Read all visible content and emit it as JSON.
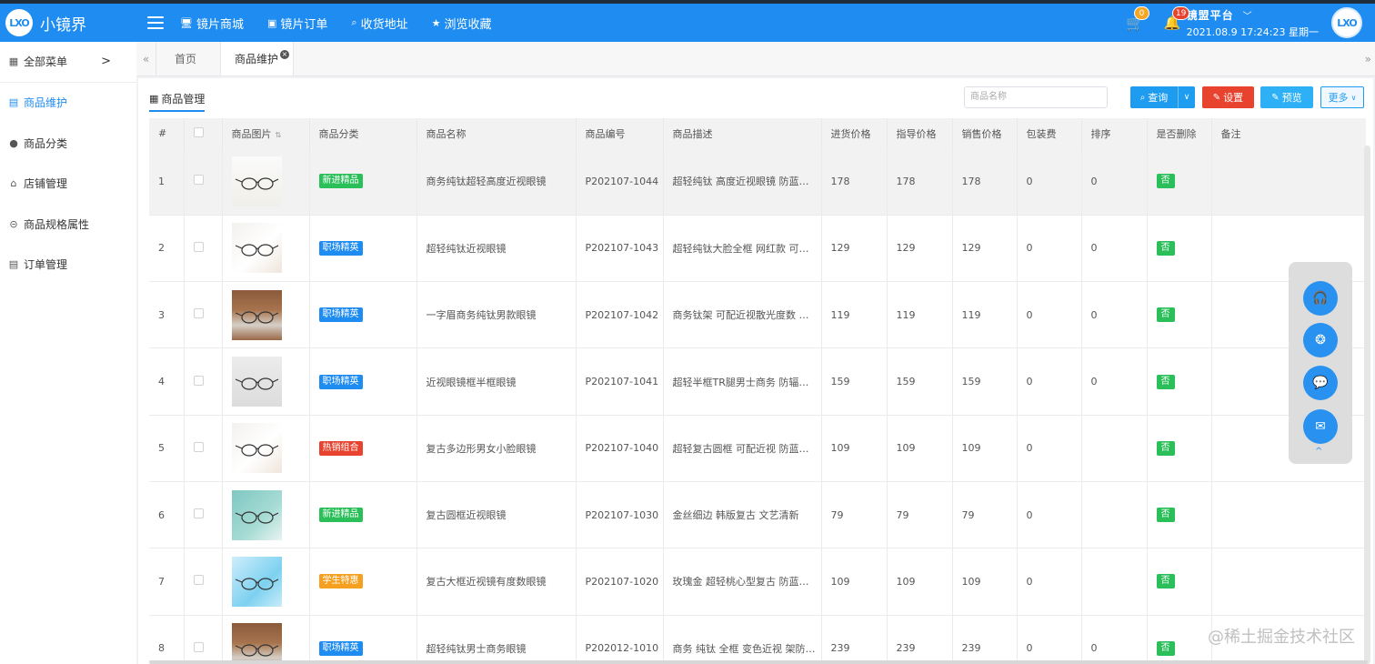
{
  "app": {
    "logo": "LXO",
    "title": "小镜界"
  },
  "nav": [
    {
      "icon": "🖥",
      "label": "镜片商城"
    },
    {
      "icon": "▣",
      "label": "镜片订单"
    },
    {
      "icon": "⌕",
      "label": "收货地址"
    },
    {
      "icon": "★",
      "label": "浏览收藏"
    }
  ],
  "topright": {
    "cart_count": "0",
    "bell_count": "19",
    "platform": "镜盟平台",
    "datetime": "2021.08.9 17:24:23 星期一",
    "avatar": "LXO"
  },
  "sidebar": [
    {
      "icon": "▦",
      "label": "全部菜单",
      "arrow": ">"
    },
    {
      "icon": "▤",
      "label": "商品维护"
    },
    {
      "icon": "●",
      "label": "商品分类"
    },
    {
      "icon": "⌂",
      "label": "店铺管理"
    },
    {
      "icon": "⊝",
      "label": "商品规格属性"
    },
    {
      "icon": "▤",
      "label": "订单管理"
    }
  ],
  "tabs": {
    "prev": "«",
    "home": "首页",
    "active": "商品维护",
    "next": "»"
  },
  "panel": {
    "title": "商品管理",
    "search_placeholder": "商品名称",
    "query_label": "查询",
    "setting_label": "设置",
    "preview_label": "预览",
    "more_label": "更多"
  },
  "table": {
    "headers": [
      "#",
      "",
      "商品图片",
      "商品分类",
      "商品名称",
      "商品编号",
      "商品描述",
      "进货价格",
      "指导价格",
      "销售价格",
      "包装费",
      "排序",
      "是否删除",
      "备注"
    ],
    "rows": [
      {
        "no": "1",
        "tag": "新进精品",
        "tag_color": "#2bbf5a",
        "name": "商务纯钛超轻高度近视眼镜",
        "code": "P202107-1044",
        "desc": "超轻纯钛 高度近视眼镜 防蓝…",
        "buy": "178",
        "guide": "178",
        "sale": "178",
        "pack": "0",
        "sort": "0",
        "del": "否",
        "img": "white"
      },
      {
        "no": "2",
        "tag": "职场精英",
        "tag_color": "#1e8cf0",
        "name": "超轻纯钛近视眼镜",
        "code": "P202107-1043",
        "desc": "超轻纯钛大脸全框 网红款 可…",
        "buy": "129",
        "guide": "129",
        "sale": "129",
        "pack": "0",
        "sort": "0",
        "del": "否",
        "img": "flowers"
      },
      {
        "no": "3",
        "tag": "职场精英",
        "tag_color": "#1e8cf0",
        "name": "一字眉商务纯钛男款眼镜",
        "code": "P202107-1042",
        "desc": "商务钛架 可配近视散光度数 …",
        "buy": "119",
        "guide": "119",
        "sale": "119",
        "pack": "0",
        "sort": "0",
        "del": "否",
        "img": "wood"
      },
      {
        "no": "4",
        "tag": "职场精英",
        "tag_color": "#1e8cf0",
        "name": "近视眼镜框半框眼镜",
        "code": "P202107-1041",
        "desc": "超轻半框TR腿男士商务 防辐…",
        "buy": "159",
        "guide": "159",
        "sale": "159",
        "pack": "0",
        "sort": "0",
        "del": "否",
        "img": "gray"
      },
      {
        "no": "5",
        "tag": "热销组合",
        "tag_color": "#e8432f",
        "name": "复古多边形男女小脸眼镜",
        "code": "P202107-1040",
        "desc": "超轻复古圆框 可配近视 防蓝…",
        "buy": "109",
        "guide": "109",
        "sale": "109",
        "pack": "0",
        "sort": "",
        "del": "否",
        "img": "flowers"
      },
      {
        "no": "6",
        "tag": "新进精品",
        "tag_color": "#2bbf5a",
        "name": "复古圆框近视眼镜",
        "code": "P202107-1030",
        "desc": "金丝细边 韩版复古 文艺清新",
        "buy": "79",
        "guide": "79",
        "sale": "79",
        "pack": "0",
        "sort": "",
        "del": "否",
        "img": "teal"
      },
      {
        "no": "7",
        "tag": "学生特惠",
        "tag_color": "#f5a020",
        "name": "复古大框近视镜有度数眼镜",
        "code": "P202107-1020",
        "desc": "玫瑰金 超轻桃心型复古 防蓝…",
        "buy": "109",
        "guide": "109",
        "sale": "109",
        "pack": "0",
        "sort": "",
        "del": "否",
        "img": "keyboard"
      },
      {
        "no": "8",
        "tag": "职场精英",
        "tag_color": "#1e8cf0",
        "name": "超轻纯钛男士商务眼镜",
        "code": "P202012-1010",
        "desc": "商务 纯钛 全框 变色近视 架防…",
        "buy": "239",
        "guide": "239",
        "sale": "239",
        "pack": "0",
        "sort": "0",
        "del": "否",
        "img": "wood"
      }
    ]
  },
  "float": {
    "icons": [
      "headset-icon",
      "aperture-icon",
      "chat-icon",
      "mail-icon"
    ],
    "up": "^"
  },
  "watermark": "@稀土掘金技术社区"
}
